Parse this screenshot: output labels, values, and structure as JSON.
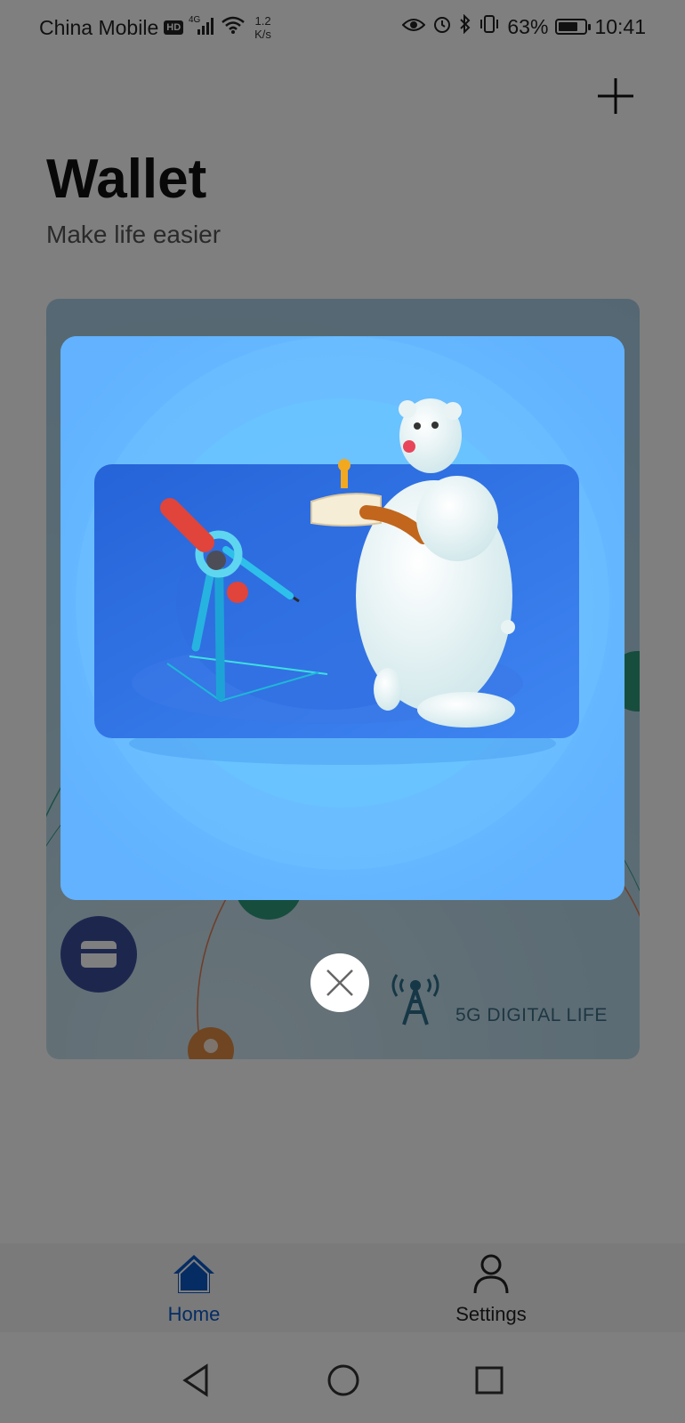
{
  "status_bar": {
    "carrier": "China Mobile",
    "hd_badge": "HD",
    "network": "4G",
    "speed_value": "1.2",
    "speed_unit": "K/s",
    "battery_percent": "63%",
    "time": "10:41"
  },
  "header": {
    "title": "Wallet",
    "subtitle": "Make life easier"
  },
  "promo_card": {
    "caption": "5G DIGITAL LIFE"
  },
  "bottom_nav": {
    "items": [
      {
        "label": "Home",
        "icon": "home-icon",
        "active": true
      },
      {
        "label": "Settings",
        "icon": "person-icon",
        "active": false
      }
    ]
  },
  "colors": {
    "accent": "#0a59c7",
    "modal_bg": "#67b7ff",
    "scene_blue": "#2b6fe0"
  }
}
